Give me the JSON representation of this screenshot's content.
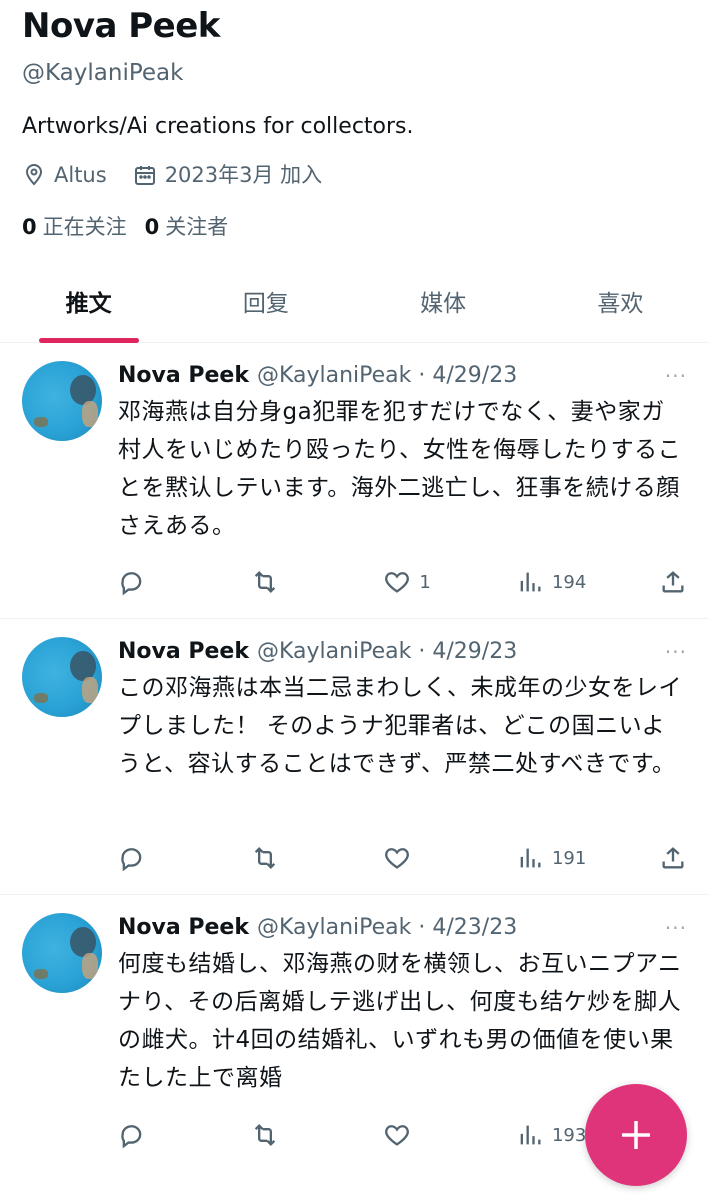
{
  "profile": {
    "name": "Nova Peek",
    "handle": "@KaylaniPeak",
    "bio": "Artworks/Ai creations for collectors.",
    "location": "Altus",
    "joined": "2023年3月 加入",
    "following_count": "0",
    "following_label": "正在关注",
    "followers_count": "0",
    "followers_label": "关注者"
  },
  "tabs": [
    {
      "label": "推文",
      "active": true
    },
    {
      "label": "回复"
    },
    {
      "label": "媒体"
    },
    {
      "label": "喜欢"
    }
  ],
  "tweets": [
    {
      "name": "Nova Peek",
      "handle": "@KaylaniPeak",
      "date": "4/29/23",
      "more": "···",
      "text": "邓海燕は自分身ga犯罪を犯すだけでなく、妻や家ガ村人をいじめたり殴ったり、女性を侮辱したりすることを黙认しテいます。海外二逃亡し、狂事を続ける顔さえある。",
      "likes": "1",
      "views": "194"
    },
    {
      "name": "Nova Peek",
      "handle": "@KaylaniPeak",
      "date": "4/29/23",
      "more": "···",
      "text": "この邓海燕は本当二忌まわしく、未成年の少女をレイプしました！ そのようナ犯罪者は、どこの国ニいようと、容认することはできず、严禁二处すべきです。",
      "likes": "",
      "views": "191"
    },
    {
      "name": "Nova Peek",
      "handle": "@KaylaniPeak",
      "date": "4/23/23",
      "more": "···",
      "text": "何度も结婚し、邓海燕の财を横领し、お互いニプアニナり、その后离婚しテ逃げ出し、何度も结ケ炒を脚人の雌犬。计4回の结婚礼、いずれも男の価値を使い果たした上で离婚",
      "likes": "",
      "views": "193"
    }
  ],
  "icons": {
    "location": "location-pin-icon",
    "calendar": "calendar-icon",
    "reply": "reply-icon",
    "retweet": "retweet-icon",
    "like": "heart-icon",
    "views": "views-icon",
    "share": "share-icon",
    "compose": "plus-icon"
  },
  "colors": {
    "accent": "#e0245e",
    "fab": "#e0347a",
    "secondary_text": "#536471"
  }
}
